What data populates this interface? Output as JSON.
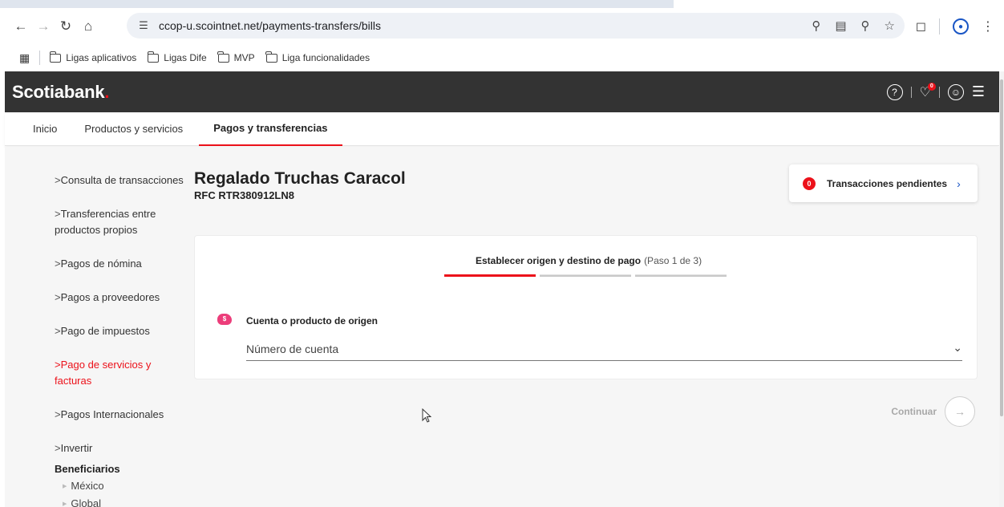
{
  "browser": {
    "url": "ccop-u.scointnet.net/payments-transfers/bills",
    "bookmarks": [
      "Ligas aplicativos",
      "Ligas Dife",
      "MVP",
      "Liga funcionalidades"
    ]
  },
  "header": {
    "logo": "Scotiabank",
    "notifications_count": "0"
  },
  "topnav": {
    "items": [
      "Inicio",
      "Productos y servicios",
      "Pagos y transferencias"
    ],
    "active": "Pagos y transferencias"
  },
  "sidebar": {
    "items": [
      "Consulta de transacciones",
      "Transferencias entre productos propios",
      "Pagos de nómina",
      "Pagos a proveedores",
      "Pago de impuestos",
      "Pago de servicios y facturas",
      "Pagos Internacionales",
      "Invertir"
    ],
    "active": "Pago de servicios y facturas",
    "section_heading": "Beneficiarios",
    "sub_items": [
      "México",
      "Global"
    ]
  },
  "client": {
    "name": "Regalado Truchas Caracol",
    "rfc": "RFC RTR380912LN8"
  },
  "pending": {
    "count": "0",
    "label": "Transacciones pendientes"
  },
  "form": {
    "step_title": "Establecer origen y destino de pago",
    "step_counter": "(Paso 1 de 3)",
    "steps_total": 3,
    "steps_done": 1,
    "origin_label": "Cuenta o producto de origen",
    "origin_placeholder": "Número de cuenta"
  },
  "actions": {
    "continue_label": "Continuar"
  },
  "colors": {
    "brand_red": "#ec111a",
    "header_bg": "#333333",
    "link_blue": "#1a56c5"
  }
}
